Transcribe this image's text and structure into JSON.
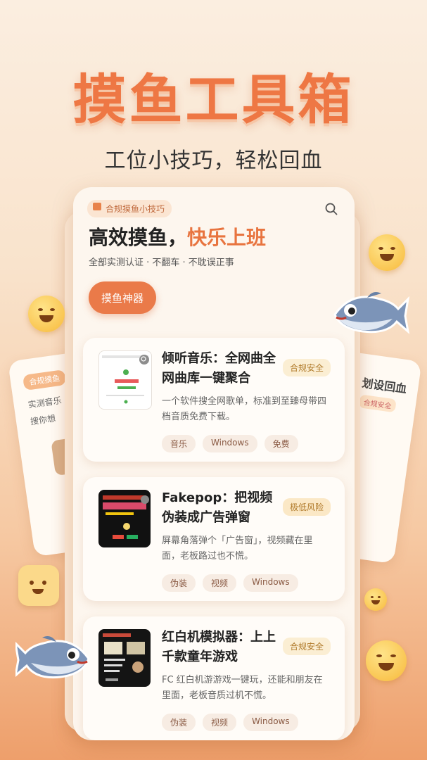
{
  "hero": {
    "title": "摸鱼工具箱",
    "subtitle": "工位小技巧，轻松回血"
  },
  "side_left": {
    "tag": "合规摸鱼",
    "line1": "实测音乐",
    "line2": "搜你想"
  },
  "side_right": {
    "title": "划设回血",
    "tag": "合规安全"
  },
  "main_card": {
    "badge": "合规摸鱼小技巧",
    "headline_plain": "高效摸鱼，",
    "headline_accent": "快乐上班",
    "subline": "全部实测认证 · 不翻车 · 不耽误正事",
    "cta": "摸鱼神器"
  },
  "apps": [
    {
      "title": "倾听音乐：全网曲全网曲库一键聚合",
      "badge": "合规安全",
      "desc": "一个软件搜全网歌单，标准到至臻母带四档音质免费下载。",
      "tags": [
        "音乐",
        "Windows",
        "免费"
      ]
    },
    {
      "title": "Fakepop：把视频伪装成广告弹窗",
      "badge": "极低风险",
      "desc": "屏幕角落弹个「广告窗」，视频藏在里面，老板路过也不慌。",
      "tags": [
        "伪装",
        "视频",
        "Windows"
      ]
    },
    {
      "title": "红白机模拟器：上上千款童年游戏",
      "badge": "合规安全",
      "desc": "FC 红白机游游戏一键玩，还能和朋友在里面，老板音质过机不慌。",
      "tags": [
        "伪装",
        "视频",
        "Windows"
      ]
    }
  ],
  "icons": {
    "search": "search-icon",
    "bag": "shopping-bag-icon",
    "fish": "fish-icon",
    "emoji": "smiley-icon"
  },
  "colors": {
    "accent": "#ea7a49",
    "title": "#ee7744"
  }
}
